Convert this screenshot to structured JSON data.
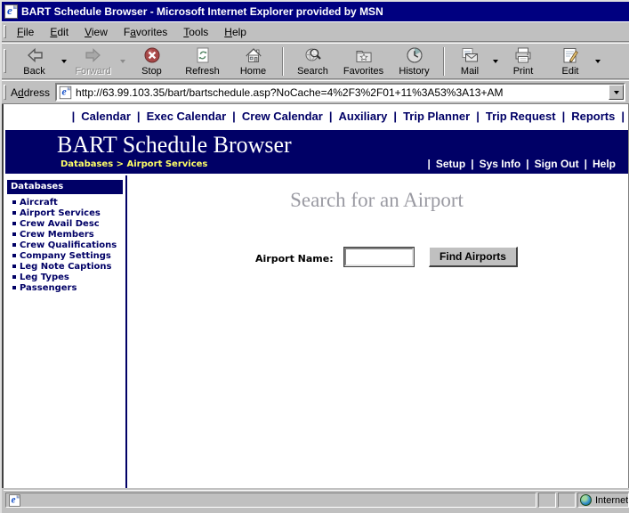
{
  "window": {
    "title": "BART Schedule Browser - Microsoft Internet Explorer provided by MSN"
  },
  "menu": {
    "items": [
      {
        "pre": "",
        "accel": "F",
        "post": "ile"
      },
      {
        "pre": "",
        "accel": "E",
        "post": "dit"
      },
      {
        "pre": "",
        "accel": "V",
        "post": "iew"
      },
      {
        "pre": "F",
        "accel": "a",
        "post": "vorites"
      },
      {
        "pre": "",
        "accel": "T",
        "post": "ools"
      },
      {
        "pre": "",
        "accel": "H",
        "post": "elp"
      }
    ]
  },
  "toolbar": {
    "back": "Back",
    "forward": "Forward",
    "stop": "Stop",
    "refresh": "Refresh",
    "home": "Home",
    "search": "Search",
    "favorites": "Favorites",
    "history": "History",
    "mail": "Mail",
    "print": "Print",
    "edit": "Edit"
  },
  "addressbar": {
    "label_pre": "A",
    "label_accel": "d",
    "label_post": "dress",
    "url": "http://63.99.103.35/bart/bartschedule.asp?NoCache=4%2F3%2F01+11%3A53%3A13+AM"
  },
  "nav": {
    "separator": "|",
    "links": [
      "Calendar",
      "Exec Calendar",
      "Crew Calendar",
      "Auxiliary",
      "Trip Planner",
      "Trip Request",
      "Reports"
    ]
  },
  "header": {
    "title": "BART Schedule Browser",
    "breadcrumb": "Databases > Airport Services",
    "separator": "|",
    "links": [
      "Setup",
      "Sys Info",
      "Sign Out",
      "Help"
    ]
  },
  "sidebar": {
    "title": "Databases",
    "items": [
      "Aircraft",
      "Airport Services",
      "Crew Avail Desc",
      "Crew Members",
      "Crew Qualifications",
      "Company Settings",
      "Leg Note Captions",
      "Leg Types",
      "Passengers"
    ]
  },
  "main": {
    "heading": "Search for an Airport",
    "form": {
      "label": "Airport Name:",
      "button": "Find Airports"
    }
  },
  "statusbar": {
    "zone": "Internet"
  },
  "colors": {
    "titlebar": "#000080",
    "header_band": "#000066",
    "breadcrumb_yellow": "#ffff66",
    "chrome_gray": "#c0c0c0",
    "link_navy": "#000066",
    "heading_gray": "#9a9aa2"
  }
}
